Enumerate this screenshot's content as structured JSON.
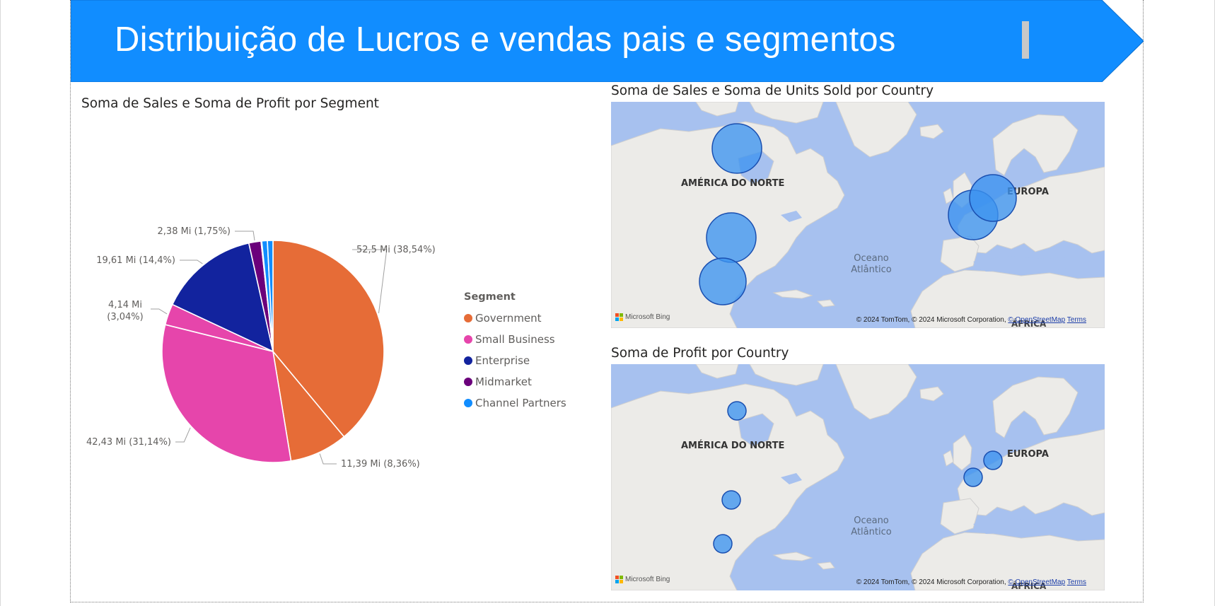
{
  "header": {
    "title": "Distribuição de Lucros e vendas pais e segmentos",
    "banner_color": "#118dff"
  },
  "pie_visual": {
    "title": "Soma de Sales e Soma de Profit por Segment",
    "legend_title": "Segment",
    "chart_data": {
      "type": "pie",
      "title": "Soma de Sales e Soma de Profit por Segment",
      "unit": "Mi",
      "slices": [
        {
          "label": "Government (Sales)",
          "value": 52.5,
          "percent": 38.54,
          "text": "52,5 Mi (38,54%)",
          "color": "#e66c37"
        },
        {
          "label": "Government (Profit)",
          "value": 11.39,
          "percent": 8.36,
          "text": "11,39 Mi (8,36%)",
          "color": "#e66c37"
        },
        {
          "label": "Small Business (Sales)",
          "value": 42.43,
          "percent": 31.14,
          "text": "42,43 Mi (31,14%)",
          "color": "#e645ab"
        },
        {
          "label": "Small Business (Profit)",
          "value": 4.14,
          "percent": 3.04,
          "text_line1": "4,14 Mi",
          "text_line2": "(3,04%)",
          "color": "#e645ab"
        },
        {
          "label": "Enterprise (Sales)",
          "value": 19.61,
          "percent": 14.4,
          "text": "19,61 Mi (14,4%)",
          "color": "#12239e"
        },
        {
          "label": "Midmarket",
          "value": 2.38,
          "percent": 1.75,
          "text": "2,38 Mi (1,75%)",
          "color": "#6b007b"
        },
        {
          "label": "Enterprise (Profit)",
          "value": 0.15,
          "percent": 0.11,
          "text": "",
          "color": "#12239e"
        },
        {
          "label": "Channel Partners (Sales)",
          "value": 1.09,
          "percent": 0.8,
          "text": "",
          "color": "#118dff"
        },
        {
          "label": "Channel Partners (Profit)",
          "value": 1.09,
          "percent": 0.8,
          "text": "",
          "color": "#118dff"
        }
      ]
    },
    "legend": [
      {
        "label": "Government",
        "color": "#e66c37"
      },
      {
        "label": "Small Business",
        "color": "#e645ab"
      },
      {
        "label": "Enterprise",
        "color": "#12239e"
      },
      {
        "label": "Midmarket",
        "color": "#6b007b"
      },
      {
        "label": "Channel Partners",
        "color": "#118dff"
      }
    ]
  },
  "map_sales": {
    "title": "Soma de Sales e Soma de Units Sold por Country",
    "labels": {
      "north_america": "AMÉRICA DO NORTE",
      "europe": "EUROPA",
      "ocean_line1": "Oceano",
      "ocean_line2": "Atlântico",
      "africa": "ÁFRICA"
    },
    "bubbles": [
      {
        "name": "Canada",
        "size": "large"
      },
      {
        "name": "United States of America",
        "size": "large"
      },
      {
        "name": "Mexico",
        "size": "medium"
      },
      {
        "name": "France",
        "size": "large"
      },
      {
        "name": "Germany",
        "size": "medium"
      }
    ]
  },
  "map_profit": {
    "title": "Soma de Profit por Country",
    "labels": {
      "north_america": "AMÉRICA DO NORTE",
      "europe": "EUROPA",
      "ocean_line1": "Oceano",
      "ocean_line2": "Atlântico",
      "africa": "ÁFRICA"
    },
    "bubbles": [
      {
        "name": "Canada",
        "size": "small"
      },
      {
        "name": "United States of America",
        "size": "small"
      },
      {
        "name": "Mexico",
        "size": "small"
      },
      {
        "name": "France",
        "size": "small"
      },
      {
        "name": "Germany",
        "size": "small"
      }
    ]
  },
  "map_common": {
    "bing_label": "Microsoft Bing",
    "attribution_text": "© 2024 TomTom, © 2024 Microsoft Corporation,",
    "osm_link": "© OpenStreetMap",
    "terms_link": "Terms"
  }
}
